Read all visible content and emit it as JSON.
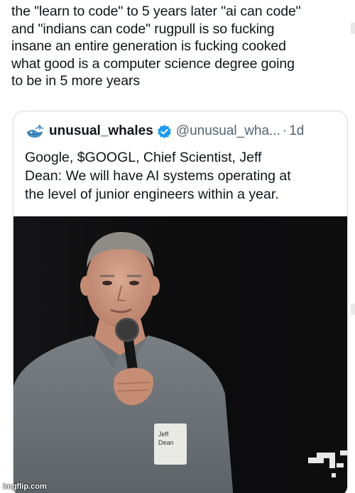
{
  "post": {
    "text": "the \"learn to code\" to 5 years later \"ai can code\"\nand \"indians can code\" rugpull is so fucking\ninsane an entire generation is fucking cooked\nwhat good is a computer science degree going\nto be in 5 more years"
  },
  "quote": {
    "display_name": "unusual_whales",
    "handle": "@unusual_wha...",
    "separator": "·",
    "time": "1d",
    "text": "Google, $GOOGL, Chief Scientist, Jeff\nDean:  We will have AI systems operating at\nthe level of junior engineers within a year.",
    "media": {
      "badge_line1": "Jeff",
      "badge_line2": "Dean"
    }
  },
  "watermark": "imgflip.com",
  "colors": {
    "text": "#0f1419",
    "muted": "#536471",
    "border": "#cfd9de",
    "verified": "#1d9bf0",
    "media_bg": "#0b0b0c"
  },
  "icons": {
    "avatar": "whale-icon",
    "verified": "verified-badge-icon"
  }
}
